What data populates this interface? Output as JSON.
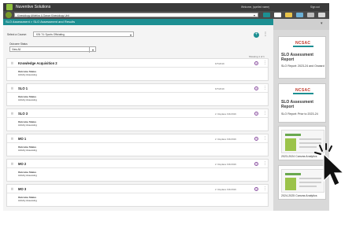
{
  "header": {
    "app_title": "Nuventive Solutions",
    "welcome": "Welcome, (spelled name)",
    "sign_out": "Sign out"
  },
  "toolbar": {
    "department": "Kinesiology Athletics & Dance Kinesiology Unit"
  },
  "breadcrumb": "SLO Assessment > SLO Assessment and Results",
  "filters": {
    "course_label": "Select a Course:",
    "course_value": "KIN 74: Sports Officiating",
    "status_label": "Outcome Status",
    "status_value": "View All",
    "showing": "Showing 1 of 1"
  },
  "cards": [
    {
      "title": "Knowledge Acquisition 2",
      "meta": "6/7/2019",
      "status_label": "Outcome Status",
      "status_value": "Activity Assessing"
    },
    {
      "title": "SLO 1",
      "meta": "6/7/2019",
      "status_label": "Outcome Status",
      "status_value": "Activity Assessing"
    },
    {
      "title": "SLO 3",
      "meta": "2. Replace 6/4/2019",
      "status_label": "Outcome Status",
      "status_value": "Activity Assessing"
    },
    {
      "title": "MO 1",
      "meta": "2. Replace 6/4/2019",
      "status_label": "Outcome Status",
      "status_value": "Activity Assessing"
    },
    {
      "title": "MO 2",
      "meta": "2. Replace 6/4/2019",
      "status_label": "Outcome Status",
      "status_value": "Activity Assessing"
    },
    {
      "title": "MO 3",
      "meta": "2. Replace 6/4/2019",
      "status_label": "Outcome Status",
      "status_value": "Activity Assessing"
    }
  ],
  "reports": [
    {
      "logo": "NCSAC",
      "title": "SLO Assessment Report",
      "subtitle": "SLO Report: 2023-24 and Onward"
    },
    {
      "logo": "NCSAC",
      "title": "SLO Assessment Report",
      "subtitle": "SLO Report: Prior to 2023-24"
    },
    {
      "subtitle": "2023-2024 Canvas Analytics"
    },
    {
      "subtitle": "2024-2025 Canvas Analytics"
    }
  ],
  "icons": {
    "drag": "drag-handle-icon",
    "add": "plus-circle-icon",
    "menu": "kebab-menu-icon",
    "cursor": "pointer-hand-icon"
  },
  "colors": {
    "teal": "#1c8f92",
    "topbar": "#3a3a3a",
    "accent_purple": "#8a4fa0",
    "brand_red": "#c0392b"
  }
}
